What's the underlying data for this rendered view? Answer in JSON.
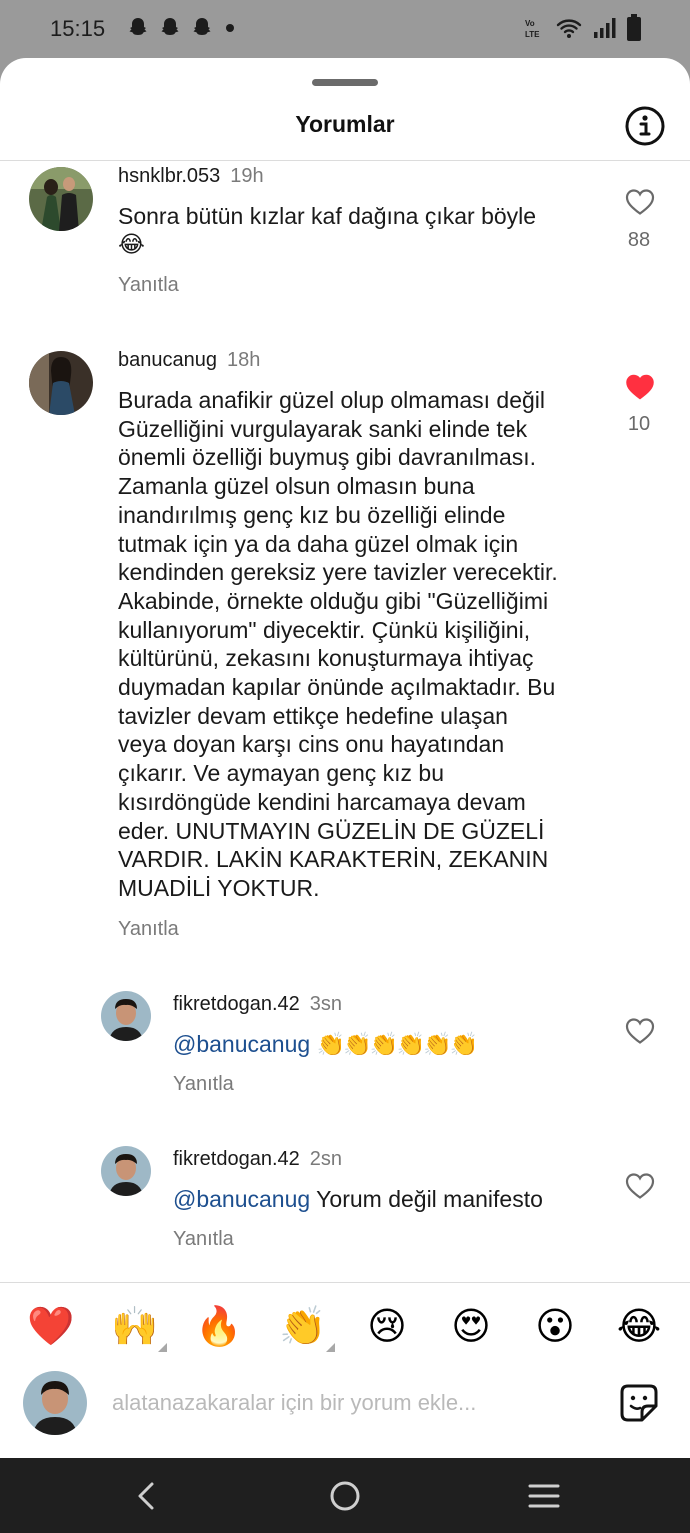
{
  "status_bar": {
    "time": "15:15",
    "icons": [
      "snapchat-ghost-icon",
      "snapchat-ghost-icon",
      "snapchat-ghost-icon",
      "dot-icon",
      "volte-icon",
      "wifi-icon",
      "signal-icon",
      "battery-icon"
    ]
  },
  "header": {
    "title": "Yorumlar",
    "info_icon": "info-icon"
  },
  "comments": [
    {
      "username": "hsnklbr.053",
      "time": "19h",
      "text_line1": "Sonra bütün kızlar kaf dağına çıkar böyle",
      "text_line2": "😂",
      "reply": "Yanıtla",
      "likes": "88",
      "liked": false
    },
    {
      "username": "banucanug",
      "time": "18h",
      "lines": [
        "Burada anafikir güzel olup olmaması değil",
        "Güzelliğini vurgulayarak sanki elinde tek",
        "önemli özelliği buymuş gibi davranılması.",
        "Zamanla güzel olsun olmasın buna",
        "inandırılmış genç kız bu özelliği elinde",
        "tutmak için ya da daha güzel olmak için",
        "kendinden gereksiz yere tavizler verecektir.",
        "Akabinde, örnekte olduğu gibi \"Güzelliğimi",
        "kullanıyorum\" diyecektir. Çünkü kişiliğini,",
        "kültürünü, zekasını konuşturmaya ihtiyaç",
        "duymadan kapılar önünde açılmaktadır. Bu",
        "tavizler devam ettikçe hedefine ulaşan",
        "veya doyan karşı cins onu hayatından",
        "çıkarır. Ve aymayan genç kız bu",
        "kısırdöngüde kendini harcamaya devam",
        "eder. UNUTMAYIN GÜZELİN DE GÜZELİ",
        "VARDIR. LAKİN KARAKTERİN, ZEKANIN",
        "MUADİLİ YOKTUR."
      ],
      "reply": "Yanıtla",
      "likes": "10",
      "liked": true
    },
    {
      "username": "fikretdogan.42",
      "time": "3sn",
      "mention": "@banucanug",
      "text": "👏👏👏👏👏👏",
      "reply": "Yanıtla",
      "liked": false
    },
    {
      "username": "fikretdogan.42",
      "time": "2sn",
      "mention": "@banucanug",
      "text": "Yorum değil manifesto",
      "reply": "Yanıtla",
      "liked": false
    }
  ],
  "emoji_bar": [
    "❤️",
    "🙌",
    "🔥",
    "👏",
    "😢",
    "😍",
    "😮",
    "😂"
  ],
  "comment_input": {
    "placeholder": "alatanazakaralar için bir yorum ekle..."
  },
  "nav": [
    "back-icon",
    "home-icon",
    "recents-icon"
  ],
  "colors": {
    "like_red": "#ff3040",
    "mention_blue": "#1d4f8f",
    "muted": "#7a7a7a"
  }
}
